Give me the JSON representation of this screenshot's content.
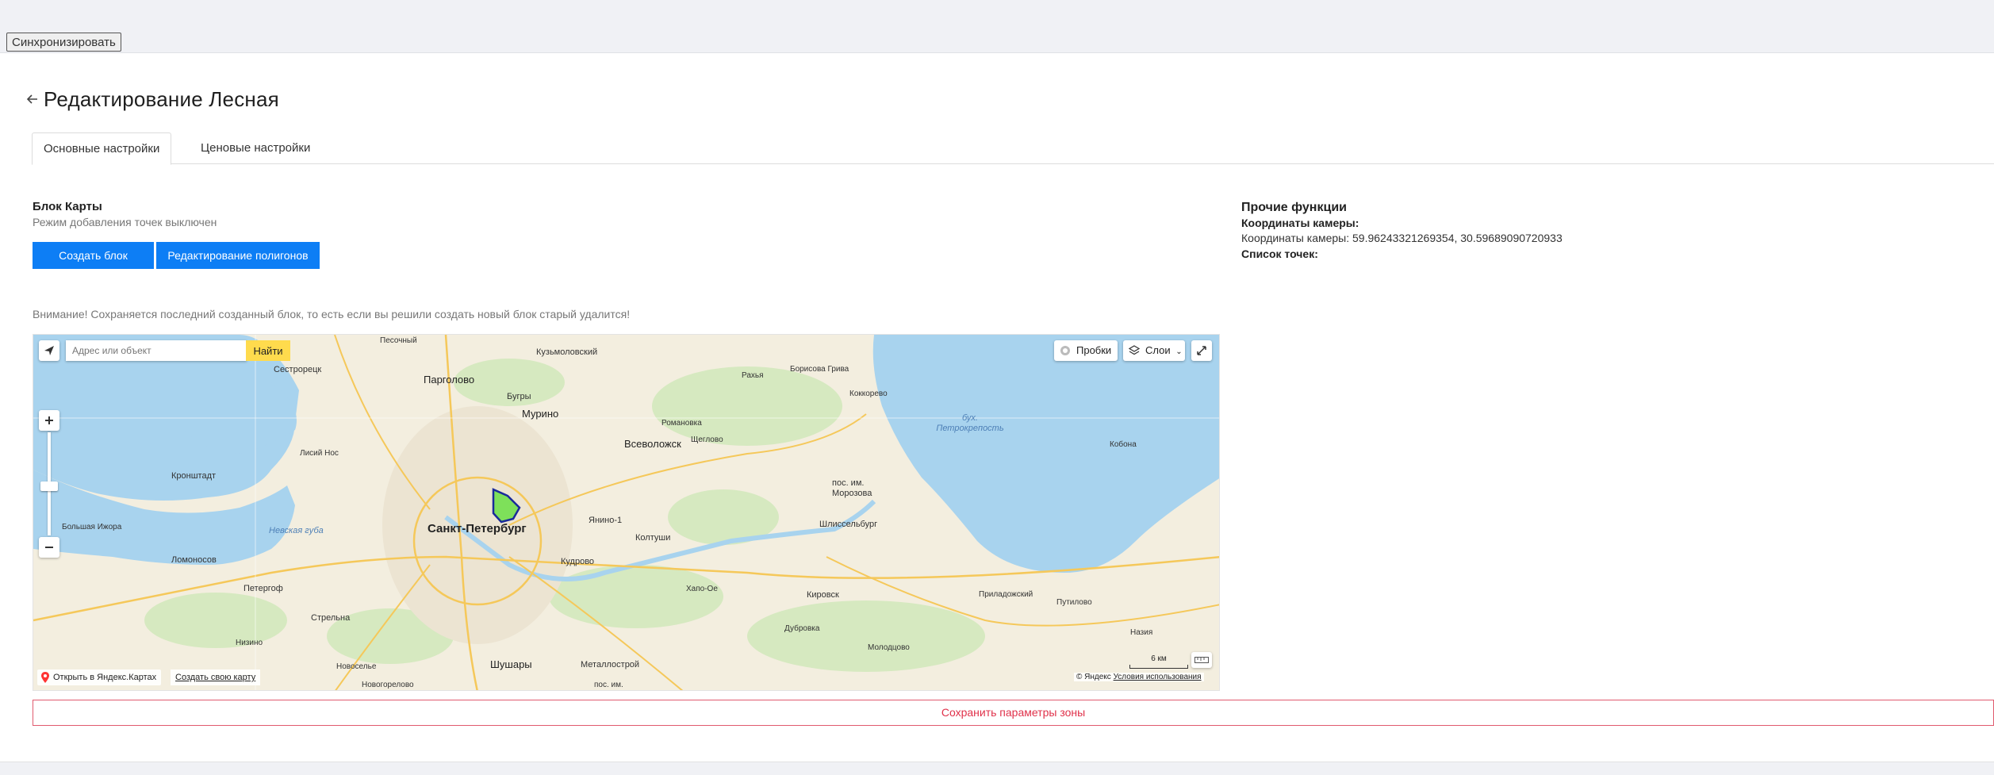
{
  "toolbar": {
    "sync_label": "Синхронизировать"
  },
  "page": {
    "title": "Редактирование Лесная"
  },
  "tabs": [
    {
      "label": "Основные настройки",
      "active": true
    },
    {
      "label": "Ценовые настройки",
      "active": false
    }
  ],
  "map_block": {
    "title": "Блок Карты",
    "mode_text": "Режим добавления точек выключен",
    "create_button": "Создать блок (выкл)",
    "edit_polygons_button": "Редактирование полигонов",
    "warning": "Внимание! Сохраняется последний созданный блок, то есть если вы решили создать новый блок старый удалится!"
  },
  "map": {
    "search_placeholder": "Адрес или объект",
    "find_button": "Найти",
    "traffic_button": "Пробки",
    "layers_button": "Слои",
    "open_yandex": "Открыть в Яндекс.Картах",
    "create_map": "Создать свою карту",
    "copyright": "© Яндекс",
    "terms": "Условия использования",
    "scale_label": "6 км",
    "labels": {
      "spb": "Санкт-Петербург",
      "pargolovo": "Парголово",
      "murino": "Мурино",
      "bugry": "Бугры",
      "vsevolozhsk": "Всеволожск",
      "kronshtadt": "Кронштадт",
      "lomonosov": "Ломоносов",
      "petergof": "Петергоф",
      "strelna": "Стрельна",
      "shushary": "Шушары",
      "metallostroy": "Металлострой",
      "kudrovo": "Кудрово",
      "yanino": "Янино-1",
      "koltushi": "Колтуши",
      "shlisselburg": "Шлиссельбург",
      "kirovsk": "Кировск",
      "morozova": "пос. им. Морозова",
      "kuzmolovsky": "Кузьмоловский",
      "sestroretsk": "Сестрорецк",
      "pesochny": "Песочный",
      "lisiy_nos": "Лисий Нос",
      "nevskaya_guba": "Невская губа",
      "bolshaya_izhora": "Большая Ижора",
      "romanovka": "Романовка",
      "scheglovo": "Щеглово",
      "rahya": "Рахья",
      "borisova_griva": "Борисова Грива",
      "kokkorevo": "Коккорево",
      "bukhta": "бух. Петрокрепость",
      "kobona": "Кобона",
      "putilovo": "Путилово",
      "prialadozhsky": "Приладожский",
      "nazia": "Назия",
      "molodtsovo": "Молодцово",
      "dubrovka": "Дубровка",
      "khapo_oe": "Хапо-Ое",
      "nizino": "Низино",
      "novoselye": "Новоселье",
      "novogorelovo": "Новогорелово",
      "pos_im": "пос. им."
    }
  },
  "other": {
    "title": "Прочие функции",
    "camera_title": "Координаты камеры:",
    "camera_value": "Координаты камеры: 59.96243321269354, 30.59689090720933",
    "points_title": "Список точек:"
  },
  "save_zone_button": "Сохранить параметры зоны",
  "colors": {
    "primary": "#0d7ef5",
    "danger": "#e0314a",
    "map_water": "#a8d3ee",
    "map_land": "#f3eedf",
    "polygon_fill": "#7ee05a",
    "polygon_stroke": "#1a2a9a",
    "find_button": "#ffdb4d"
  },
  "icons": {
    "back": "arrow-left-icon",
    "geolocation": "geolocation-icon",
    "traffic": "traffic-icon",
    "layers": "layers-icon",
    "fullscreen": "fullscreen-icon",
    "ruler": "ruler-icon",
    "pin": "map-pin-icon"
  }
}
